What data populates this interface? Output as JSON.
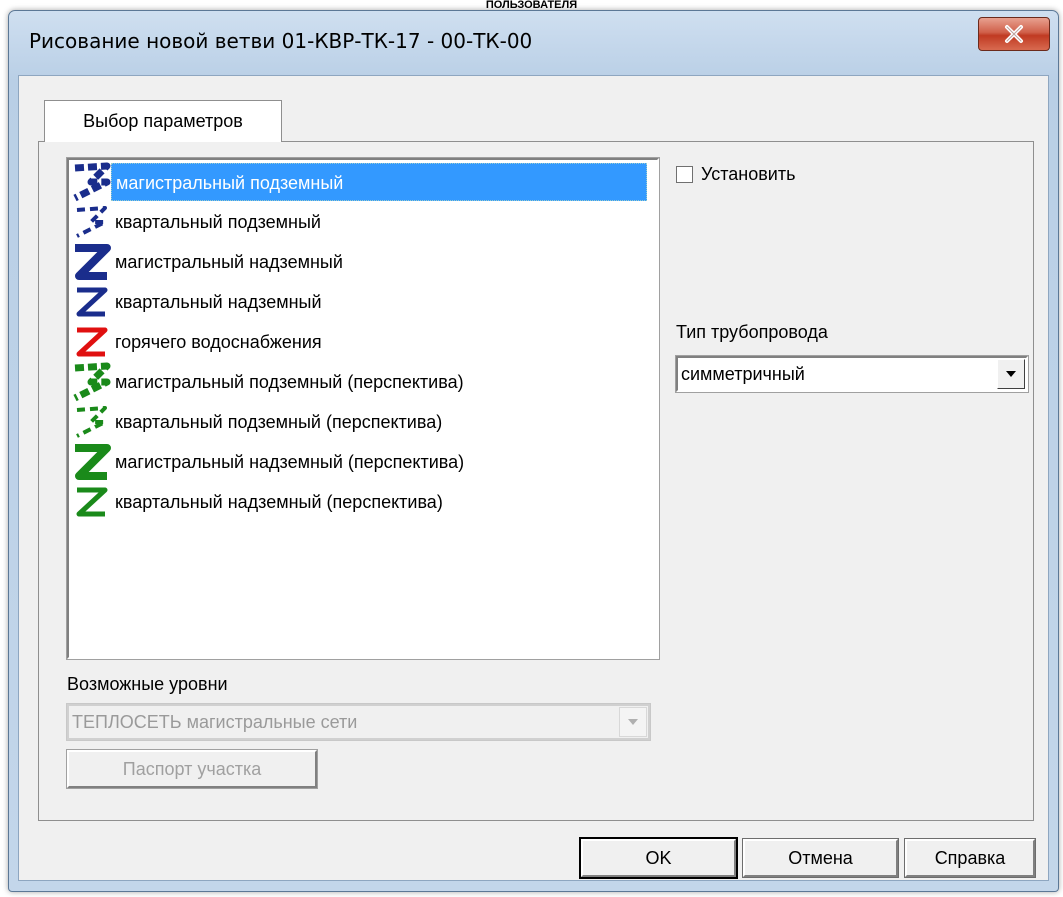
{
  "top_caption": "ПОЛЬЗОВАТЕЛЯ",
  "window": {
    "title": "Рисование новой ветви 01-КВР-ТК-17 - 00-ТК-00",
    "close_glyph": "✕"
  },
  "tab": {
    "label": "Выбор параметров"
  },
  "branch_list": {
    "items": [
      {
        "label": "магистральный подземный",
        "color": "#1a2d8c",
        "style": "underground-main",
        "selected": true
      },
      {
        "label": "квартальный подземный",
        "color": "#1a2d8c",
        "style": "underground-quarter",
        "selected": false
      },
      {
        "label": "магистральный надземный",
        "color": "#1a2d8c",
        "style": "overground-main",
        "selected": false
      },
      {
        "label": "квартальный надземный",
        "color": "#1a2d8c",
        "style": "overground-quarter",
        "selected": false
      },
      {
        "label": "горячего водоснабжения",
        "color": "#e01010",
        "style": "overground-quarter",
        "selected": false
      },
      {
        "label": "магистральный подземный (перспектива)",
        "color": "#1a8a1a",
        "style": "underground-main",
        "selected": false
      },
      {
        "label": "квартальный подземный (перспектива)",
        "color": "#1a8a1a",
        "style": "underground-quarter",
        "selected": false
      },
      {
        "label": "магистральный надземный (перспектива)",
        "color": "#1a8a1a",
        "style": "overground-main",
        "selected": false
      },
      {
        "label": "квартальный надземный (перспектива)",
        "color": "#1a8a1a",
        "style": "overground-quarter",
        "selected": false
      }
    ]
  },
  "install_checkbox": {
    "label": "Установить",
    "checked": false
  },
  "pipe_type": {
    "label": "Тип трубопровода",
    "value": "симметричный"
  },
  "levels": {
    "label": "Возможные уровни",
    "value": "ТЕПЛОСЕТЬ магистральные сети",
    "enabled": false
  },
  "passport_button": {
    "label": "Паспорт участка",
    "enabled": false
  },
  "buttons": {
    "ok": "OK",
    "cancel": "Отмена",
    "help": "Справка"
  }
}
